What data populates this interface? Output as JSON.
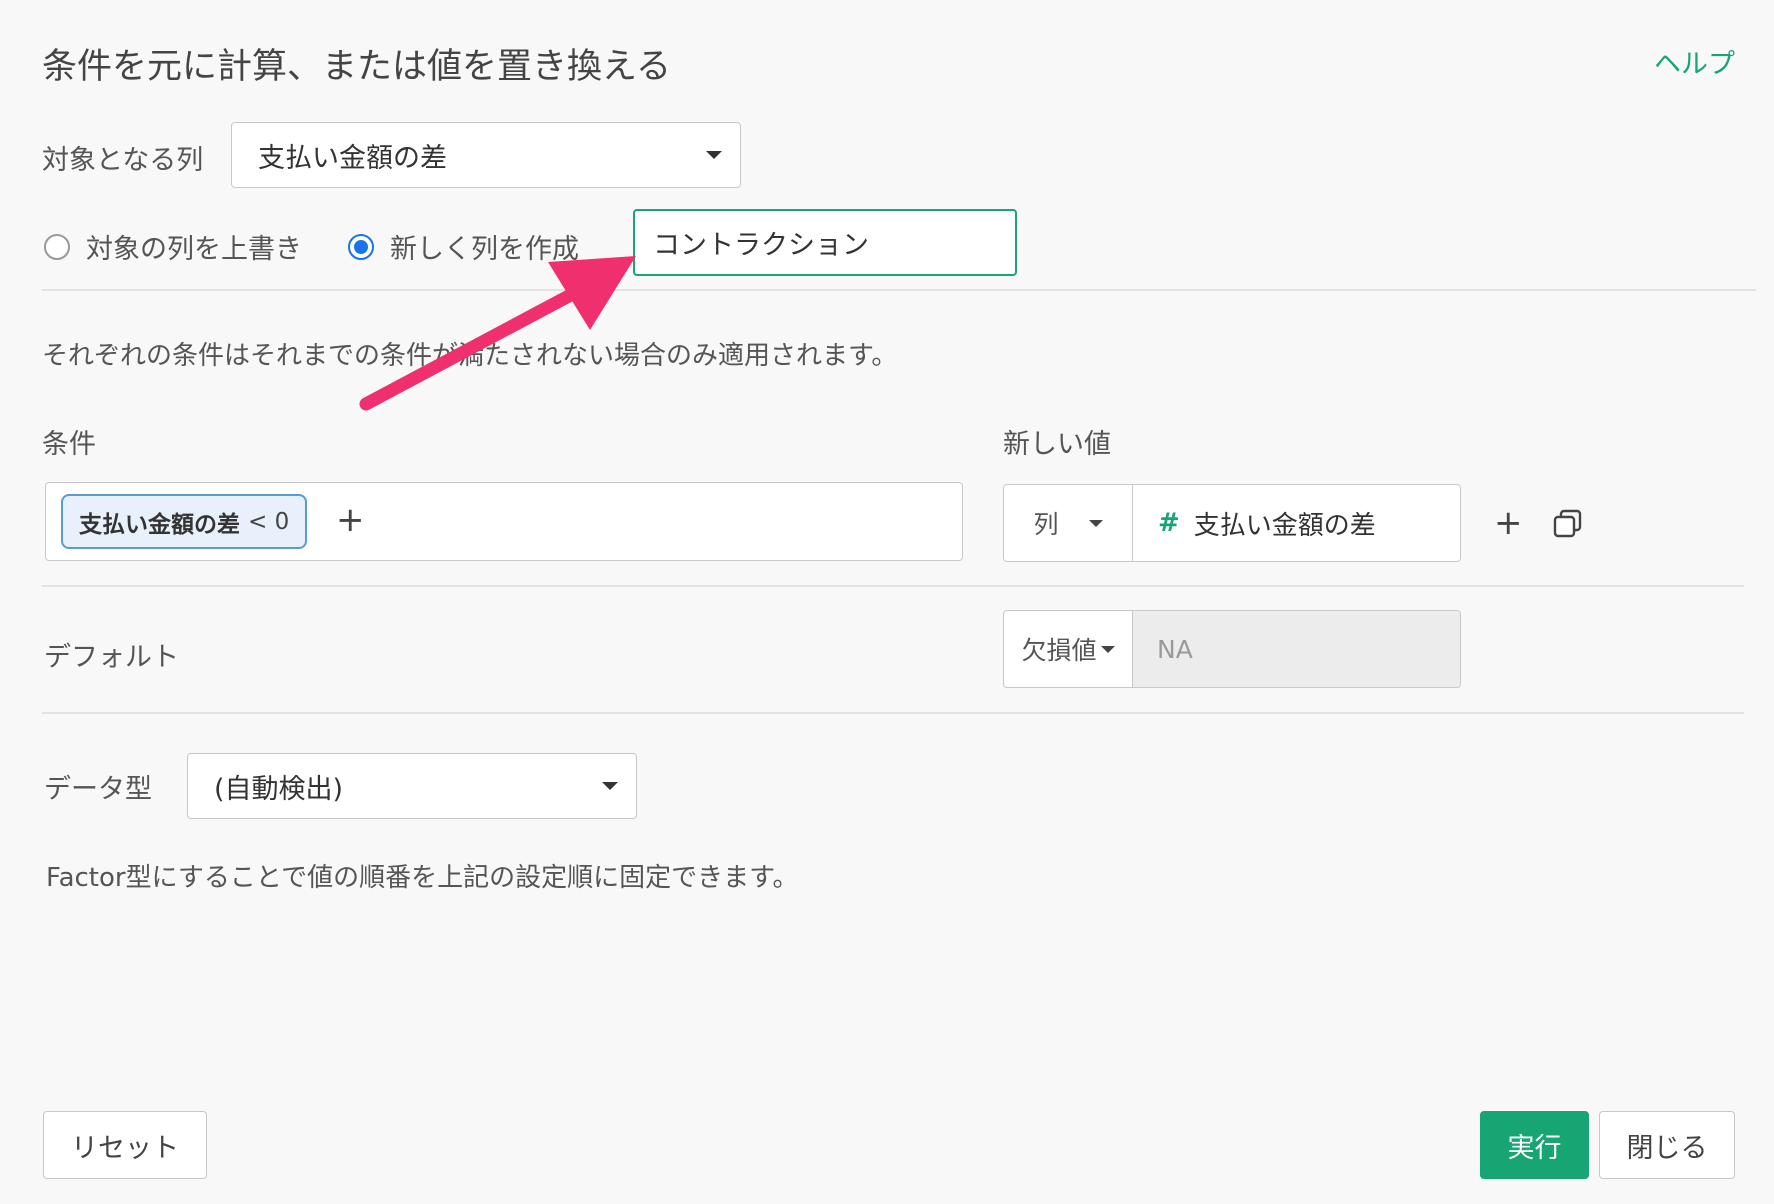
{
  "dialog": {
    "title": "条件を元に計算、または値を置き換える",
    "help_label": "ヘルプ"
  },
  "target_column": {
    "label": "対象となる列",
    "value": "支払い金額の差"
  },
  "mode": {
    "overwrite_label": "対象の列を上書き",
    "new_column_label": "新しく列を作成",
    "selected": "new_column",
    "new_column_name": "コントラクション"
  },
  "note": "それぞれの条件はそれまでの条件が満たされない場合のみ適用されます。",
  "conditions": {
    "header_condition": "条件",
    "header_new_value": "新しい値",
    "rows": [
      {
        "chip_column": "支払い金額の差",
        "chip_operator": "< 0",
        "value_type": "列",
        "value_column_icon": "#",
        "value_column": "支払い金額の差"
      }
    ]
  },
  "default": {
    "label": "デフォルト",
    "type": "欠損値",
    "value": "NA"
  },
  "data_type": {
    "label": "データ型",
    "value": "(自動検出)",
    "note": "Factor型にすることで値の順番を上記の設定順に固定できます。"
  },
  "footer": {
    "reset_label": "リセット",
    "run_label": "実行",
    "close_label": "閉じる"
  },
  "colors": {
    "accent_green": "#17a673",
    "radio_blue": "#1a73e8",
    "chip_border": "#5b9bd5",
    "annotation_arrow": "#f0306e"
  }
}
